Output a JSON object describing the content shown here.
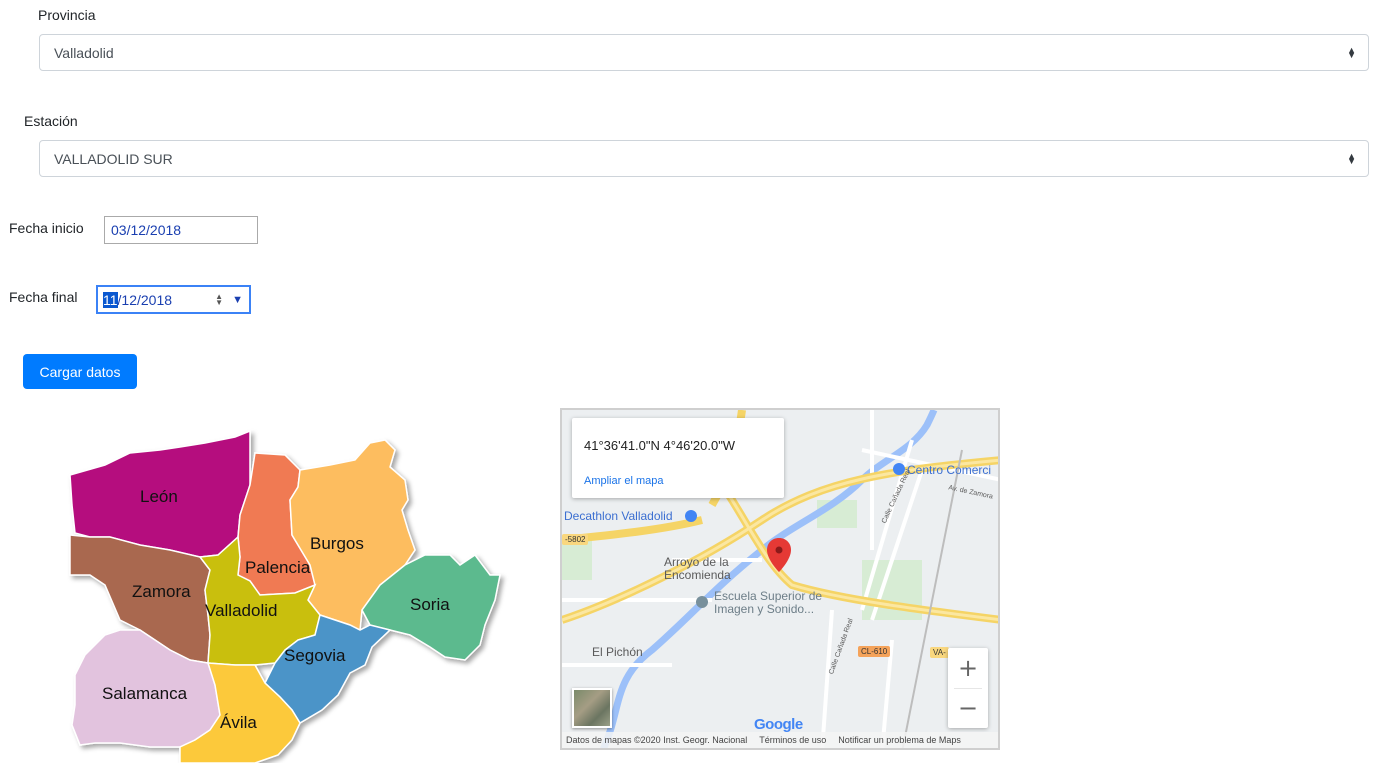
{
  "form": {
    "provincia": {
      "label": "Provincia",
      "selected": "Valladolid"
    },
    "estacion": {
      "label": "Estación",
      "selected": "VALLADOLID SUR"
    },
    "fecha_inicio": {
      "label": "Fecha inicio",
      "value": "03/12/2018"
    },
    "fecha_final": {
      "label": "Fecha final",
      "day": "11",
      "rest": "/12/2018"
    },
    "submit_label": "Cargar datos"
  },
  "region_map": {
    "regions": [
      {
        "name": "León",
        "color": "#b5117e"
      },
      {
        "name": "Palencia",
        "color": "#f07a52"
      },
      {
        "name": "Burgos",
        "color": "#fdbd5e"
      },
      {
        "name": "Zamora",
        "color": "#a9674f"
      },
      {
        "name": "Valladolid",
        "color": "#c9bf10"
      },
      {
        "name": "Soria",
        "color": "#5cba8e"
      },
      {
        "name": "Segovia",
        "color": "#4b94c8"
      },
      {
        "name": "Salamanca",
        "color": "#e2c3de"
      },
      {
        "name": "Ávila",
        "color": "#fcc93a"
      }
    ]
  },
  "google_map": {
    "coords": "41°36'41.0\"N 4°46'20.0\"W",
    "enlarge_link": "Ampliar el mapa",
    "places": {
      "centro": "Centro Comerci",
      "decathlon": "Decathlon Valladolid",
      "arroyo_1": "Arroyo de la",
      "arroyo_2": "Encomienda",
      "escuela_1": "Escuela Superior de",
      "escuela_2": "Imagen y Sonido...",
      "pichon": "El Pichón",
      "av_zamora": "Av. de Zamora",
      "calle_1": "Calle Cañada Real",
      "calle_2": "Calle Cañada Real"
    },
    "road_signs": {
      "a": "-5802",
      "b": "CL-610",
      "c": "VA-"
    },
    "zoom_in": "+",
    "zoom_out": "−",
    "google_logo": "Google",
    "footer": {
      "data": "Datos de mapas ©2020 Inst. Geogr. Nacional",
      "terms": "Términos de uso",
      "report": "Notificar un problema de Maps"
    },
    "colors": {
      "marker": "#e53935",
      "road_major": "#f6d96b",
      "river": "#8ab4f8",
      "park": "#c8e6c9",
      "poi": "#4285f4"
    }
  }
}
